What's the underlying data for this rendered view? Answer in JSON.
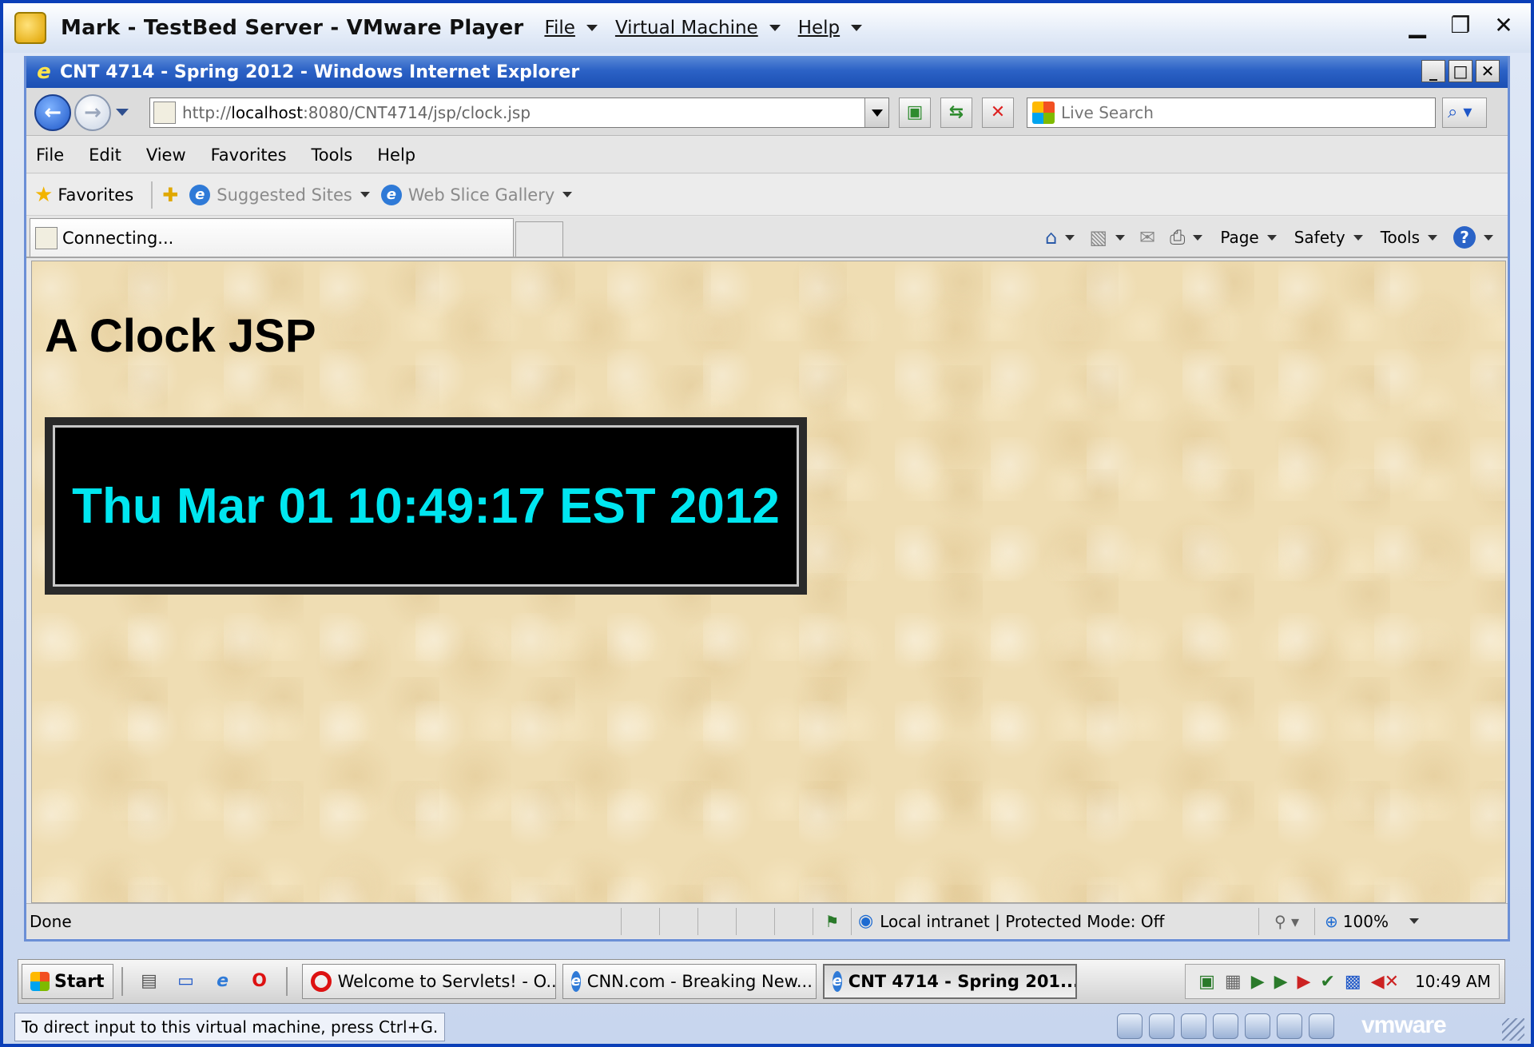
{
  "vmware": {
    "title": "Mark - TestBed Server - VMware Player",
    "menu": [
      "File",
      "Virtual Machine",
      "Help"
    ],
    "hint": "To direct input to this virtual machine, press Ctrl+G.",
    "brand": "vmware",
    "window_buttons": {
      "minimize": "▁",
      "maximize": "❐",
      "close": "✕"
    }
  },
  "ie": {
    "title": "CNT 4714 - Spring 2012 - Windows Internet Explorer",
    "url_prefix": "http://",
    "url_host": "localhost",
    "url_rest": ":8080/CNT4714/jsp/clock.jsp",
    "search_placeholder": "Live Search",
    "menu": [
      "File",
      "Edit",
      "View",
      "Favorites",
      "Tools",
      "Help"
    ],
    "favorites_label": "Favorites",
    "fav_links": [
      "Suggested Sites",
      "Web Slice Gallery"
    ],
    "tab_label": "Connecting...",
    "commands": [
      "Page",
      "Safety",
      "Tools"
    ],
    "status": "Done",
    "zone": "Local intranet | Protected Mode: Off",
    "zoom": "100%"
  },
  "page": {
    "heading": "A Clock JSP",
    "clock": "Thu Mar 01 10:49:17 EST 2012"
  },
  "taskbar": {
    "start_label": "Start",
    "tasks": [
      {
        "label": "Welcome to Servlets! - O...",
        "icon": "opera-icon"
      },
      {
        "label": "CNN.com - Breaking New...",
        "icon": "ie-icon"
      },
      {
        "label": "CNT 4714 - Spring 201...",
        "icon": "ie-icon",
        "active": true
      }
    ],
    "clock": "10:49 AM"
  },
  "colors": {
    "clock_text": "#00e6f0",
    "content_bg": "#efddb3",
    "ie_title": "#2c62c6"
  }
}
